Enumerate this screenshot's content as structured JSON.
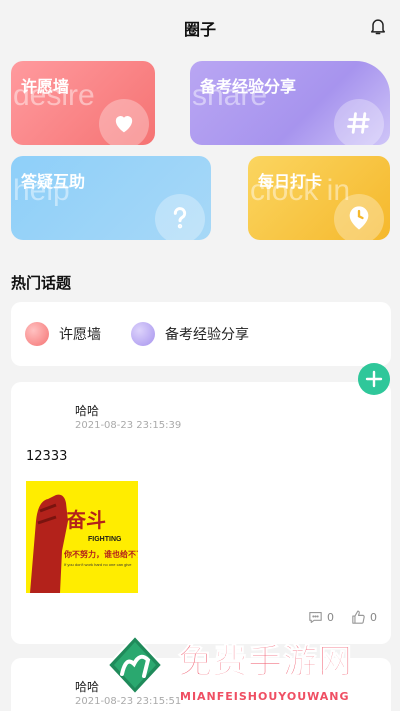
{
  "header": {
    "title": "圈子",
    "bell_icon": "bell-icon"
  },
  "cards": [
    {
      "label": "许愿墙",
      "watermark": "desire",
      "icon": "heart-icon",
      "color": "#f57373"
    },
    {
      "label": "备考经验分享",
      "watermark": "share",
      "icon": "hash-icon",
      "color": "#a794ee"
    },
    {
      "label": "答疑互助",
      "watermark": "help",
      "icon": "question-icon",
      "color": "#8ecff9"
    },
    {
      "label": "每日打卡",
      "watermark": "clock in",
      "icon": "location-clock-icon",
      "color": "#f5b82c"
    }
  ],
  "hot_topics": {
    "title": "热门话题",
    "items": [
      {
        "label": "许愿墙",
        "color": "#f57373"
      },
      {
        "label": "备考经验分享",
        "color": "#a794ee"
      }
    ]
  },
  "posts": [
    {
      "author": "哈哈",
      "time": "2021-08-23 23:15:39",
      "content": "12333",
      "image": {
        "big_text": "奋斗",
        "fighting": "FIGHTING",
        "slogan": "你不努力，谁也给不了你",
        "small_line": "If you don't work hard no one can give"
      },
      "comments": "0",
      "likes": "0"
    },
    {
      "author": "哈哈",
      "time": "2021-08-23 23:15:51"
    }
  ],
  "fab_icon": "plus-icon",
  "watermark": {
    "cn": "免费手游网",
    "en": "MIANFEISHOUYOUWANG"
  },
  "accent": "#2fc79a"
}
